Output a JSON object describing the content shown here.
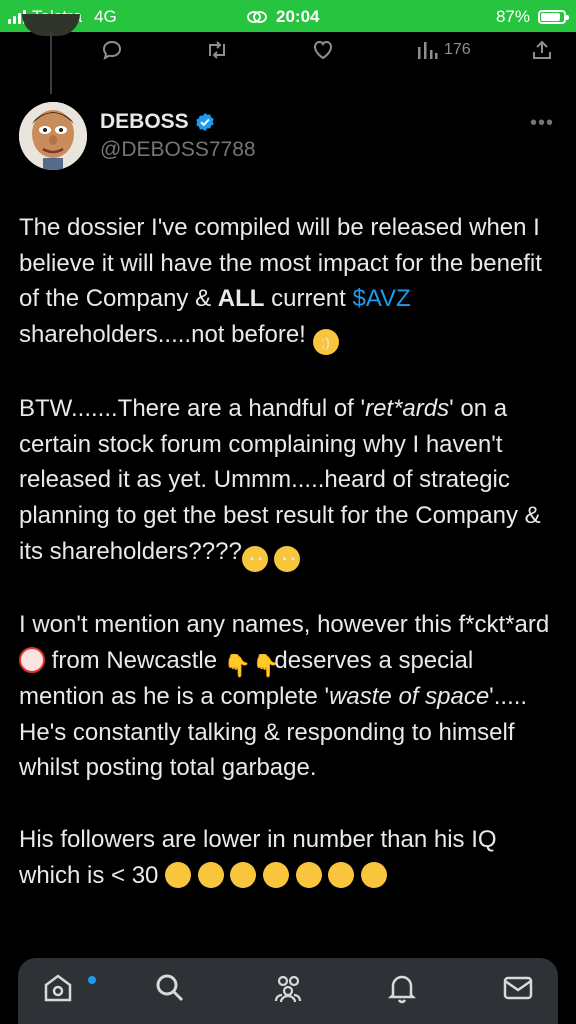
{
  "status_bar": {
    "carrier": "Telstra",
    "network": "4G",
    "time": "20:04",
    "battery_percent": "87%",
    "battery_level": 0.87
  },
  "actions": {
    "views_count": "176"
  },
  "tweet": {
    "display_name": "DEBOSS",
    "handle": "@DEBOSS7788",
    "p1_a": "The dossier I've compiled will be released when I believe it will have the most impact for the benefit of the Company & ",
    "p1_bold": "ALL",
    "p1_b": " current ",
    "p1_cashtag": "$AVZ",
    "p1_c": " shareholders.....not before! ",
    "p2_a": "BTW.......There are a handful of '",
    "p2_italic": "ret*ards",
    "p2_b": "' on a certain stock forum complaining why I haven't released it as yet.  Ummm.....heard of strategic planning to get the best result for the Company & its shareholders????",
    "p3_a": "I won't mention any names, however this f*ckt*ard ",
    "p3_b": " from Newcastle ",
    "p3_c": "deserves a special mention as he is a complete '",
    "p3_italic": "waste of space",
    "p3_d": "'.....  He's constantly talking & responding to himself whilst posting total garbage.",
    "p4": "His followers are lower in number than his IQ which is < 30 "
  },
  "icons": {
    "reply": "reply-icon",
    "retweet": "retweet-icon",
    "like": "like-icon",
    "views": "views-icon",
    "share": "share-icon",
    "verified": "verified-badge-icon",
    "more": "more-icon",
    "home": "home-icon",
    "search": "search-icon",
    "communities": "communities-icon",
    "notifications": "notifications-icon",
    "messages": "messages-icon"
  },
  "colors": {
    "status_bar": "#27c53f",
    "accent": "#1d9bf0",
    "background": "#000000",
    "nav_bar": "#2e3135"
  }
}
